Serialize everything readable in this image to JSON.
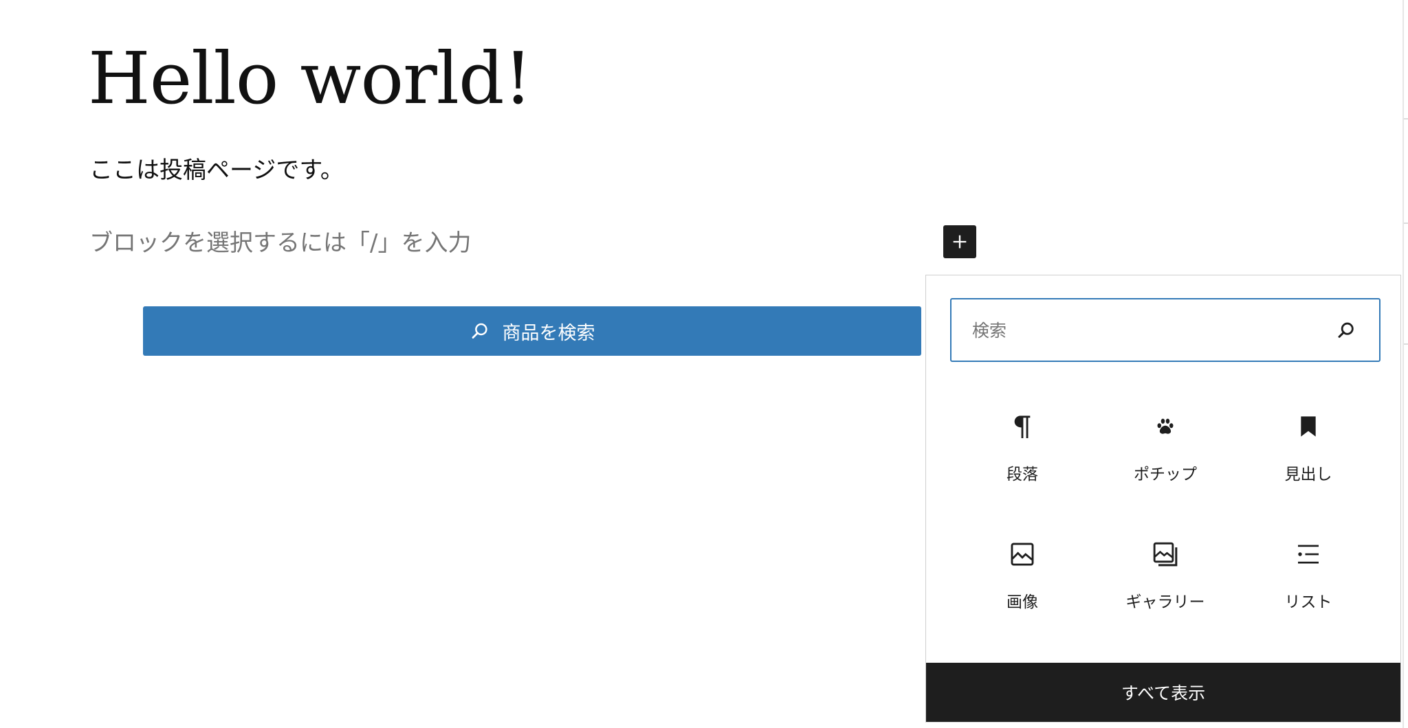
{
  "post": {
    "title": "Hello world!",
    "body": "ここは投稿ページです。",
    "placeholder": "ブロックを選択するには「/」を入力"
  },
  "product_search": {
    "label": "商品を検索",
    "icon": "search-icon",
    "color": "#337ab7"
  },
  "inserter": {
    "toggle_icon": "plus-icon",
    "search": {
      "placeholder": "検索",
      "icon": "search-icon"
    },
    "blocks": [
      {
        "label": "段落",
        "icon": "paragraph-icon"
      },
      {
        "label": "ポチップ",
        "icon": "paw-icon"
      },
      {
        "label": "見出し",
        "icon": "bookmark-icon"
      },
      {
        "label": "画像",
        "icon": "image-icon"
      },
      {
        "label": "ギャラリー",
        "icon": "gallery-icon"
      },
      {
        "label": "リスト",
        "icon": "list-icon"
      }
    ],
    "show_all_label": "すべて表示"
  },
  "colors": {
    "accent": "#337ab7",
    "dark": "#1e1e1e",
    "placeholder_text": "#757575"
  }
}
